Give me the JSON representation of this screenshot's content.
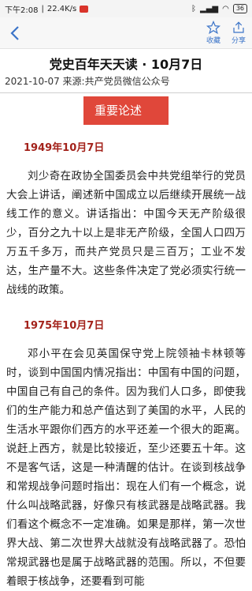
{
  "status_bar": {
    "time": "下午2:08",
    "speed": "22.4K/s",
    "battery": "36"
  },
  "app_bar": {
    "favorite_label": "收藏",
    "share_label": "分享"
  },
  "article": {
    "title": "党史百年天天读 · 10月7日",
    "meta": "2021-10-07 来源:共产党员微信公众号",
    "section_label": "重要论述",
    "entries": [
      {
        "date": "1949年10月7日",
        "text": "刘少奇在政协全国委员会中共党组举行的党员大会上讲话，阐述新中国成立以后继续开展统一战线工作的意义。讲话指出：中国今天无产阶级很少，百分之九十以上是非无产阶级，全国人口四万万五千多万，而共产党员只是三百万；工业不发达，生产量不大。这些条件决定了党必须实行统一战线的政策。"
      },
      {
        "date": "1975年10月7日",
        "text": "邓小平在会见英国保守党上院领袖卡林顿等时，谈到中国国内情况指出：中国有中国的问题，中国自己有自己的条件。因为我们人口多，即使我们的生产能力和总产值达到了美国的水平，人民的生活水平跟你们西方的水平还差一个很大的距离。说赶上西方，就是比较接近，至少还要五十年。这不是客气话，这是一种清醒的估计。在谈到核战争和常规战争问题时指出：现在人们有一个概念，说什么叫战略武器，好像只有核武器是战略武器。我们看这个概念不一定准确。如果是那样，第一次世界大战、第二次世界大战就没有战略武器了。恐怕常规武器也是属于战略武器的范围。所以，不但要着眼于核战争，还要看到可能"
      }
    ]
  }
}
